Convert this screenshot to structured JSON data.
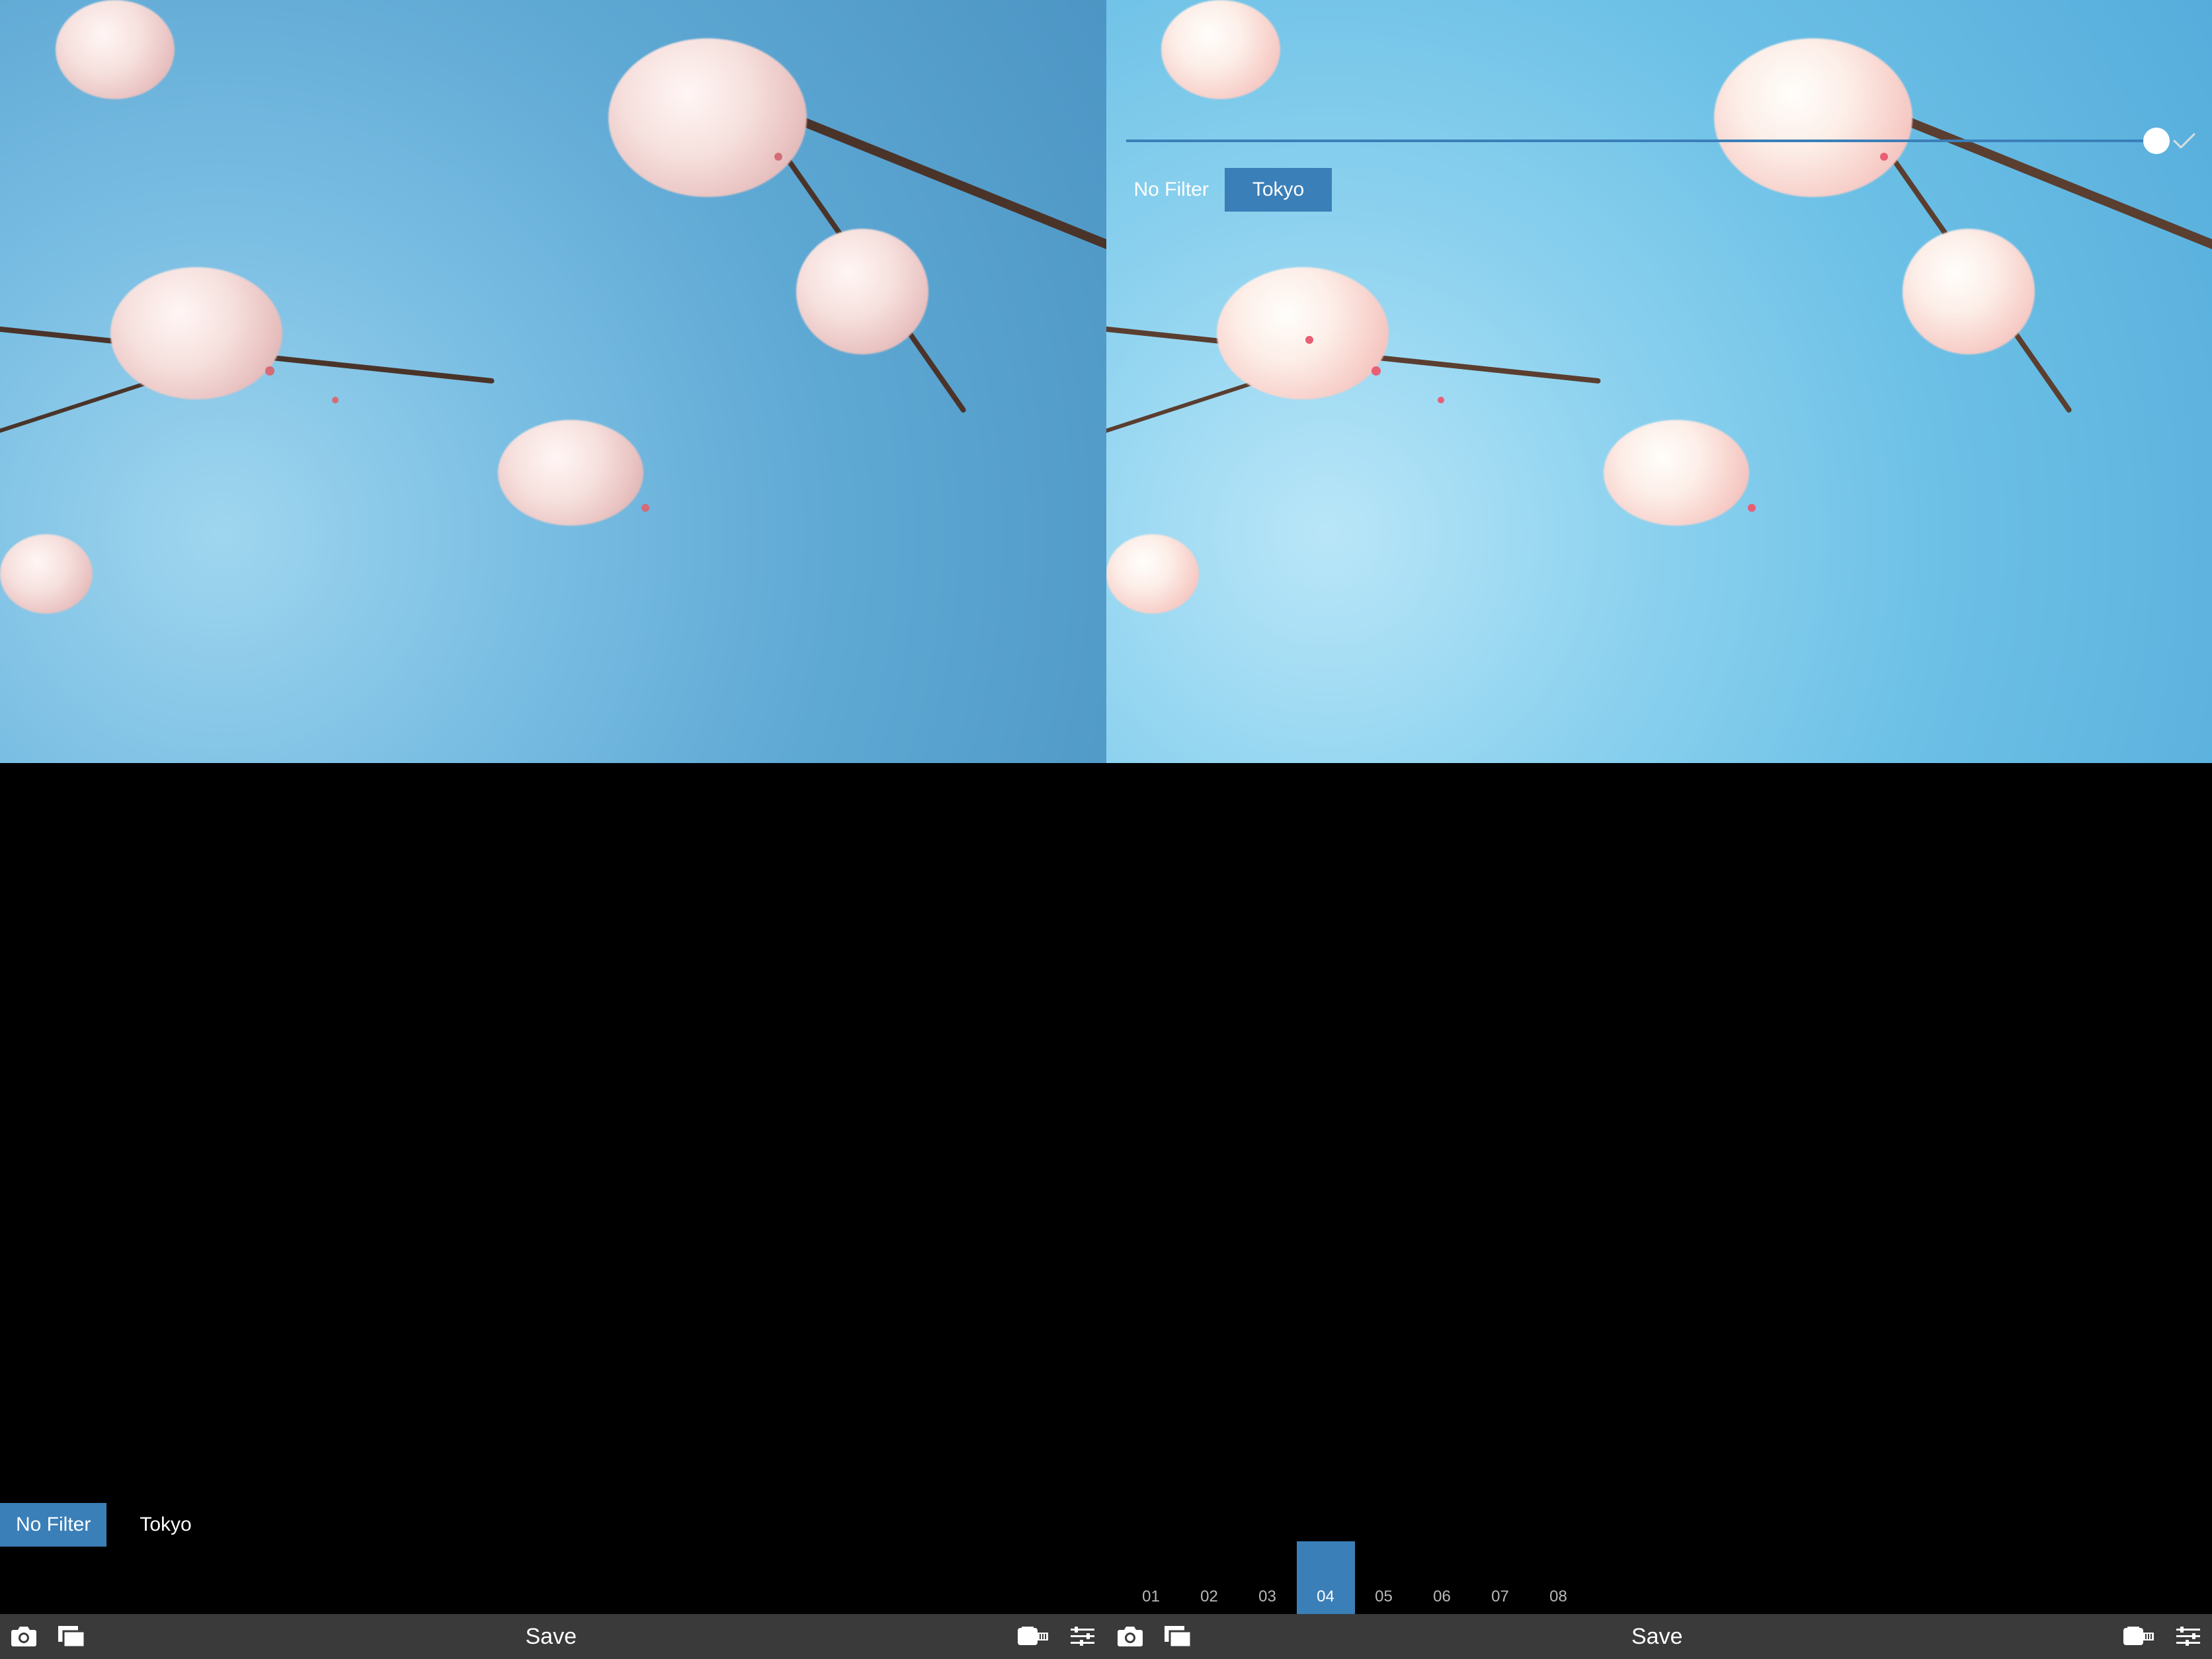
{
  "left": {
    "filters": [
      {
        "label": "No Filter",
        "selected": true
      },
      {
        "label": "Tokyo",
        "selected": false
      }
    ],
    "toolbar": {
      "save_label": "Save"
    }
  },
  "right": {
    "filters": [
      {
        "label": "No Filter",
        "selected": false
      },
      {
        "label": "Tokyo",
        "selected": true
      }
    ],
    "subfilters": [
      {
        "label": "01",
        "selected": false
      },
      {
        "label": "02",
        "selected": false
      },
      {
        "label": "03",
        "selected": false
      },
      {
        "label": "04",
        "selected": true
      },
      {
        "label": "05",
        "selected": false
      },
      {
        "label": "06",
        "selected": false
      },
      {
        "label": "07",
        "selected": false
      },
      {
        "label": "08",
        "selected": false
      }
    ],
    "slider": {
      "value": 100
    },
    "toolbar": {
      "save_label": "Save"
    }
  },
  "colors": {
    "accent": "#3b7fb8",
    "toolbar": "#3a3a3a"
  }
}
